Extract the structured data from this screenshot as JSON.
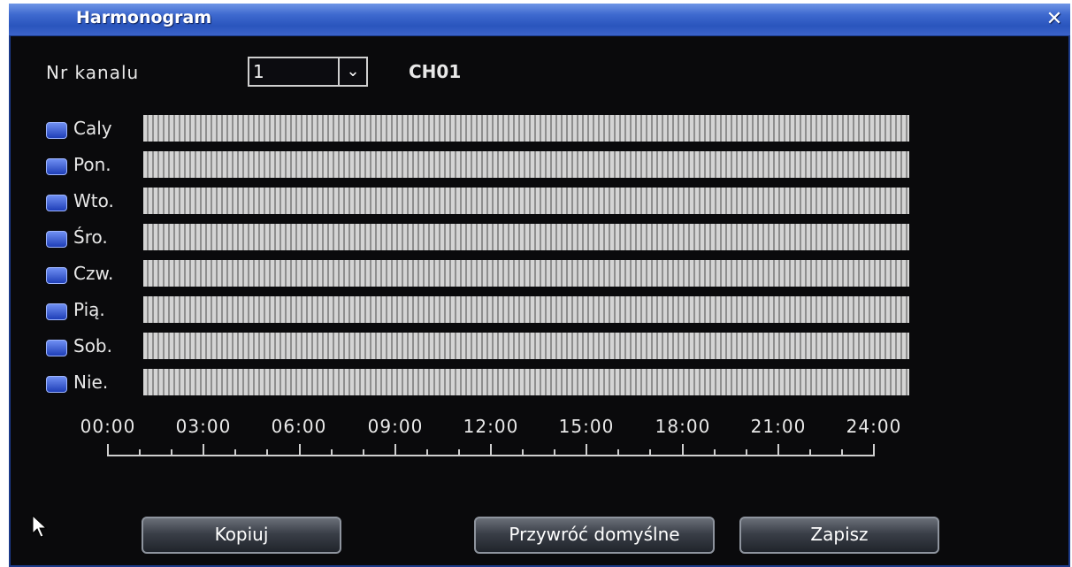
{
  "window": {
    "title": "Harmonogram",
    "close_glyph": "✕"
  },
  "channel": {
    "label": "Nr kanalu",
    "value": "1",
    "name": "CH01"
  },
  "days": [
    {
      "label": "Caly"
    },
    {
      "label": "Pon."
    },
    {
      "label": "Wto."
    },
    {
      "label": "Śro."
    },
    {
      "label": "Czw."
    },
    {
      "label": "Pią."
    },
    {
      "label": "Sob."
    },
    {
      "label": "Nie."
    }
  ],
  "timeline": {
    "labels": [
      "00:00",
      "03:00",
      "06:00",
      "09:00",
      "12:00",
      "15:00",
      "18:00",
      "21:00",
      "24:00"
    ]
  },
  "buttons": {
    "copy": "Kopiuj",
    "defaults": "Przywróć domyślne",
    "save": "Zapisz"
  },
  "colors": {
    "titlebar": "#3e69cf",
    "checkbox": "#3f5fd8",
    "bar": "#d4d4d4"
  }
}
